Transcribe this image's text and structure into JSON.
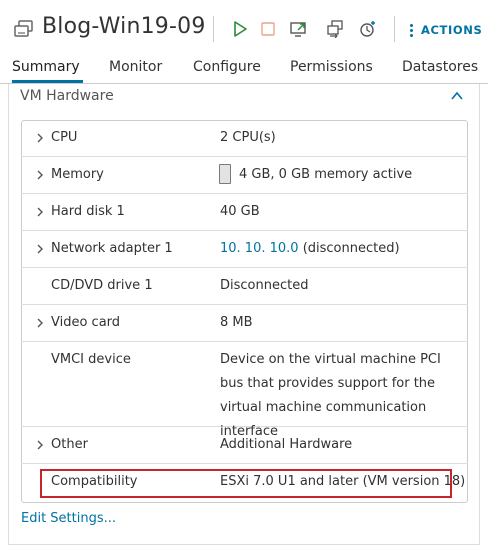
{
  "header": {
    "vm_name": "Blog-Win19-09",
    "actions_label": "ACTIONS",
    "icons": [
      "vm-icon",
      "power-on-icon",
      "power-off-icon",
      "launch-console-icon",
      "migrate-icon",
      "snapshot-icon"
    ],
    "colors": {
      "power_on": "#2e8b3a",
      "power_off": "#e9a48c",
      "accent": "#0072a3"
    }
  },
  "tabs": [
    {
      "label": "Summary",
      "active": true
    },
    {
      "label": "Monitor"
    },
    {
      "label": "Configure"
    },
    {
      "label": "Permissions"
    },
    {
      "label": "Datastores"
    }
  ],
  "card": {
    "title": "VM Hardware",
    "rows": [
      {
        "label": "CPU",
        "value": "2 CPU(s)",
        "expandable": true
      },
      {
        "label": "Memory",
        "value": "4 GB, 0 GB memory active",
        "expandable": true
      },
      {
        "label": "Hard disk 1",
        "value": "40 GB",
        "expandable": true
      },
      {
        "label": "Network adapter 1",
        "value_link": "10. 10. 10.0",
        "value": "(disconnected)",
        "expandable": true
      },
      {
        "label": "CD/DVD drive 1",
        "value": "Disconnected",
        "expandable": false
      },
      {
        "label": "Video card",
        "value": "8 MB",
        "expandable": true
      },
      {
        "label": "VMCI device",
        "value": "Device on the virtual machine PCI bus that provides support for the virtual machine communication interface",
        "expandable": false
      },
      {
        "label": "Other",
        "value": "Additional Hardware",
        "expandable": true
      },
      {
        "label": "Compatibility",
        "value": "ESXi 7.0 U1 and later (VM version 18)",
        "expandable": false,
        "highlighted": true
      }
    ],
    "edit_settings": "Edit Settings..."
  }
}
